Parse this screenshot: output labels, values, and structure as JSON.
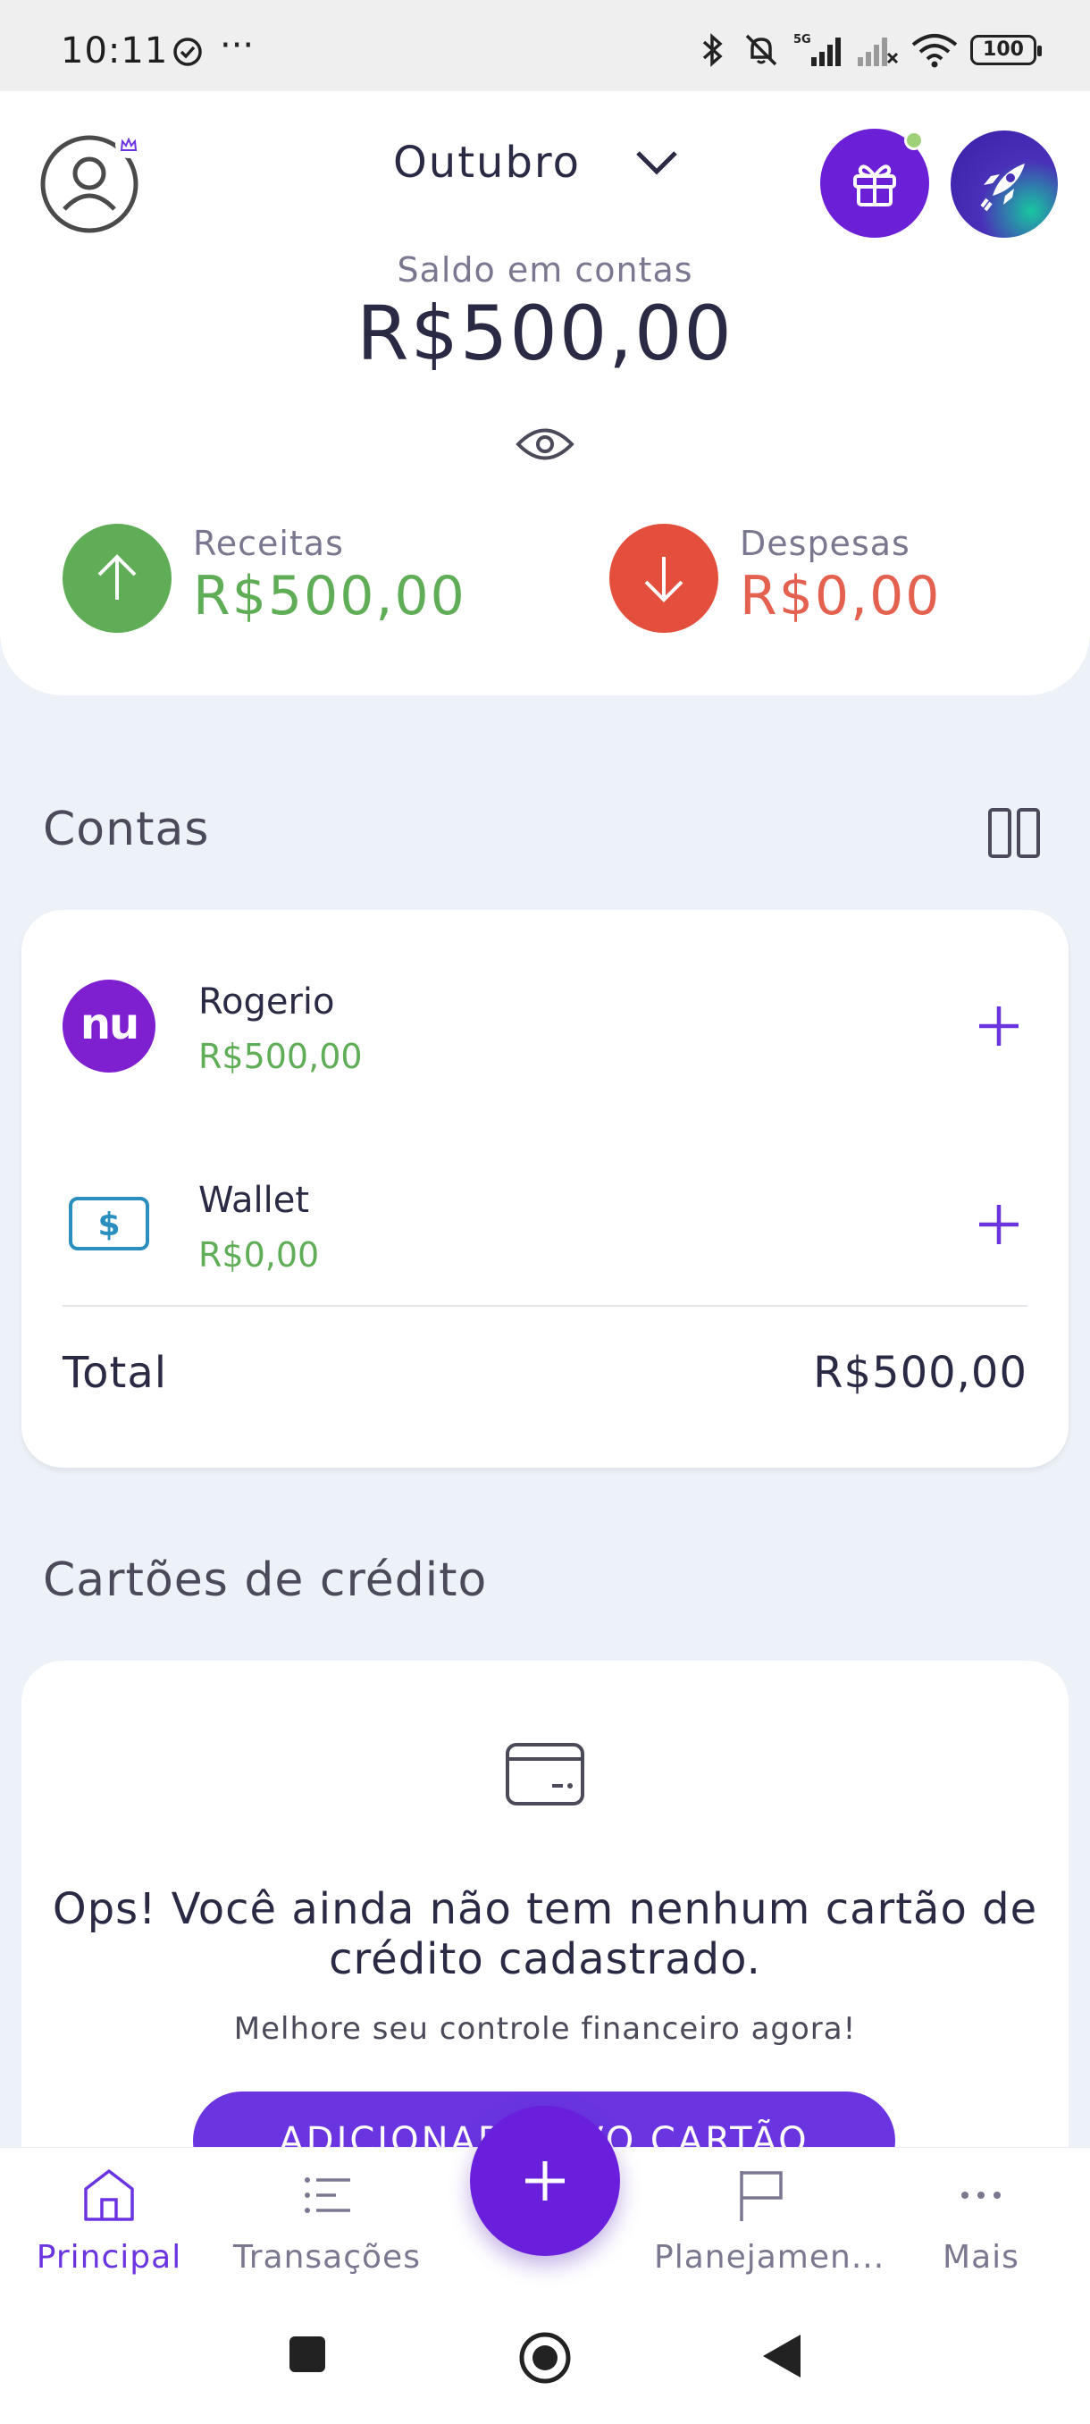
{
  "status_bar": {
    "time": "10:11",
    "battery": "100",
    "network": "5G"
  },
  "header": {
    "month": "Outubro",
    "saldo_label": "Saldo em contas",
    "saldo_value": "R$500,00",
    "receitas_label": "Receitas",
    "receitas_value": "R$500,00",
    "despesas_label": "Despesas",
    "despesas_value": "R$0,00"
  },
  "accounts": {
    "title": "Contas",
    "items": [
      {
        "name": "Rogerio",
        "balance": "R$500,00",
        "icon": "nu"
      },
      {
        "name": "Wallet",
        "balance": "R$0,00",
        "icon": "wallet-icon"
      }
    ],
    "total_label": "Total",
    "total_value": "R$500,00"
  },
  "credit_cards": {
    "title": "Cartões de crédito",
    "empty_title": "Ops! Você ainda não tem nenhum cartão de crédito cadastrado.",
    "empty_subtitle": "Melhore seu controle financeiro agora!",
    "add_button": "ADICIONAR NOVO CARTÃO"
  },
  "bottom_nav": {
    "items": [
      {
        "label": "Principal",
        "icon": "home-icon",
        "active": true
      },
      {
        "label": "Transações",
        "icon": "list-icon"
      },
      {
        "label": "Planejamen...",
        "icon": "flag-icon"
      },
      {
        "label": "Mais",
        "icon": "more-icon"
      }
    ]
  },
  "colors": {
    "primary": "#6a35e0",
    "income": "#5fad56",
    "expense": "#e44e3c",
    "background": "#edf1f8"
  }
}
